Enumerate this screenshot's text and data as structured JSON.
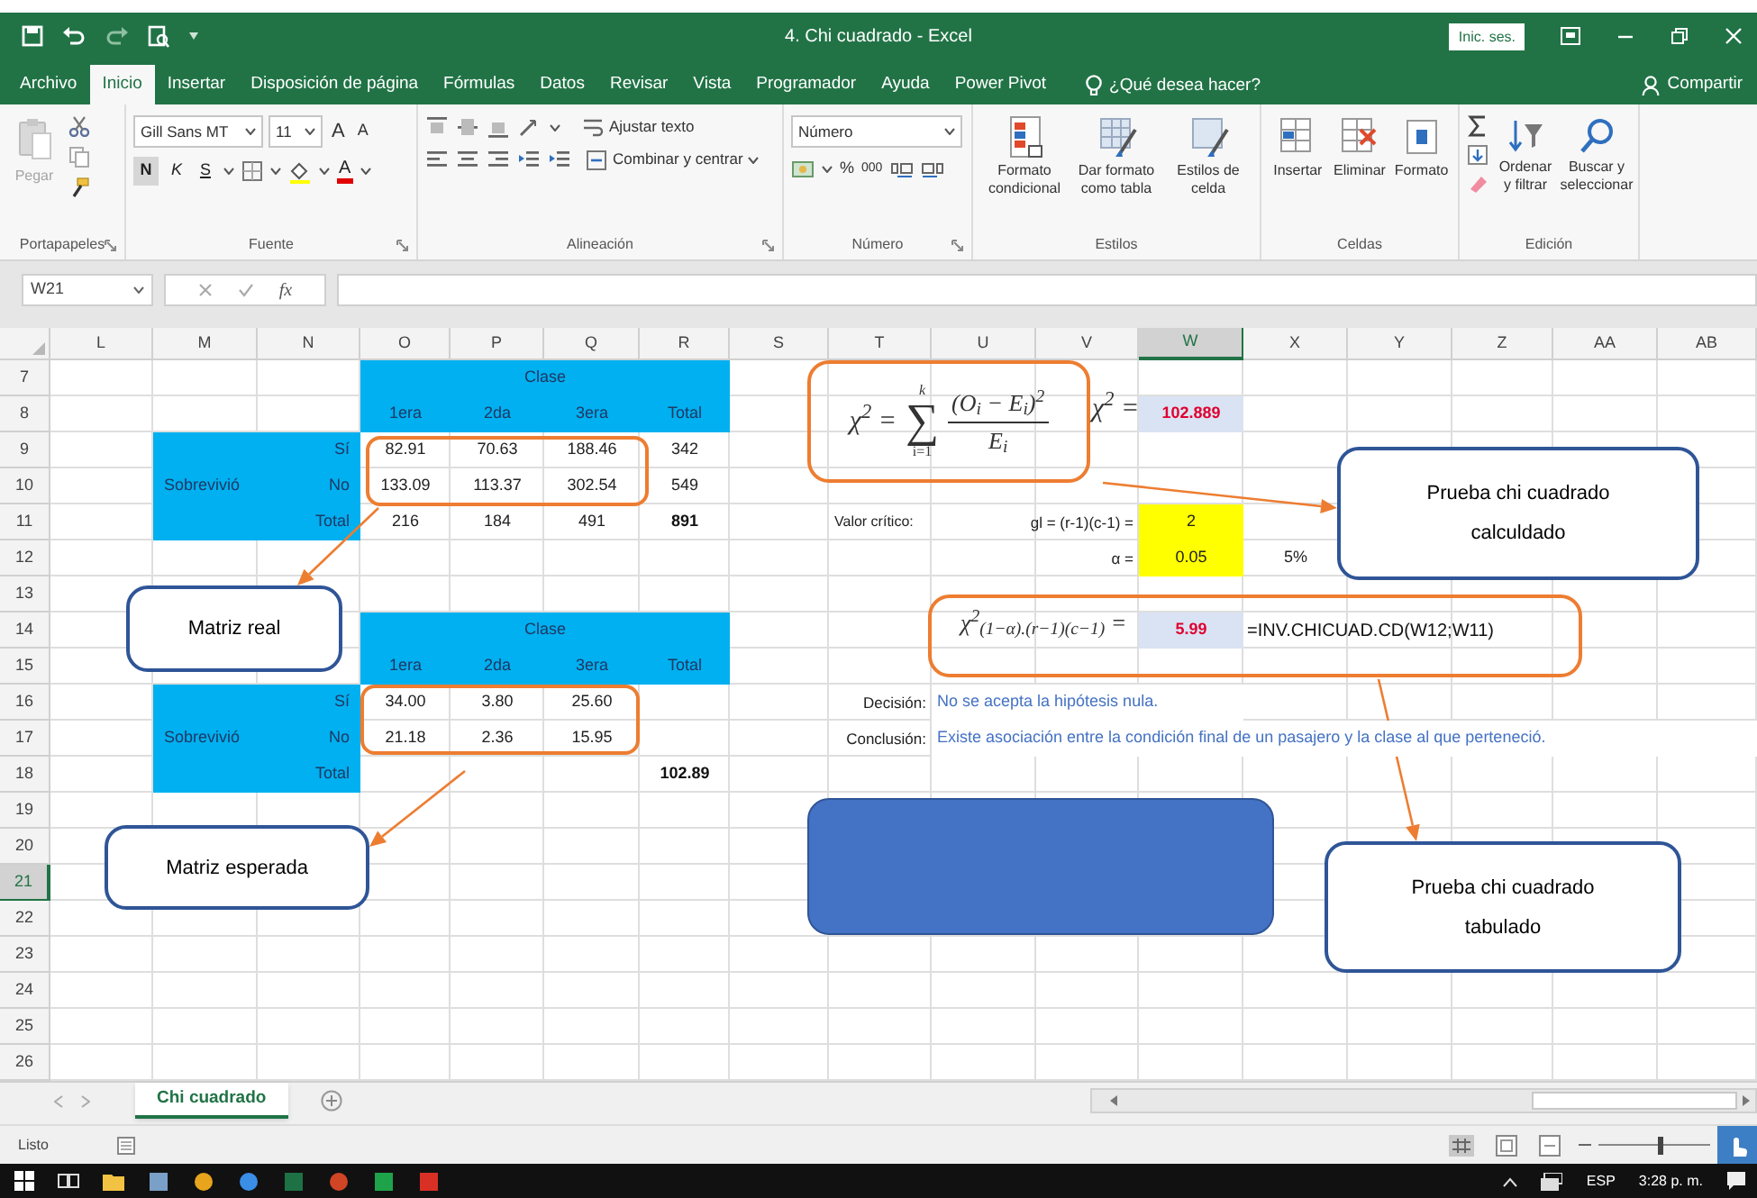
{
  "window": {
    "title": "4. Chi cuadrado - Excel",
    "sign_in": "Inic. ses."
  },
  "menu_tabs": [
    {
      "label": "Archivo",
      "selected": false
    },
    {
      "label": "Inicio",
      "selected": true
    },
    {
      "label": "Insertar",
      "selected": false
    },
    {
      "label": "Disposición de página",
      "selected": false
    },
    {
      "label": "Fórmulas",
      "selected": false
    },
    {
      "label": "Datos",
      "selected": false
    },
    {
      "label": "Revisar",
      "selected": false
    },
    {
      "label": "Vista",
      "selected": false
    },
    {
      "label": "Programador",
      "selected": false
    },
    {
      "label": "Ayuda",
      "selected": false
    },
    {
      "label": "Power Pivot",
      "selected": false
    }
  ],
  "tell_me": {
    "placeholder": "¿Qué desea hacer?"
  },
  "share": "Compartir",
  "ribbon": {
    "clipboard": {
      "paste": {
        "label": "Pegar",
        "disabled": true
      },
      "label": "Portapapeles"
    },
    "font": {
      "name": "Gill Sans MT",
      "size": "11",
      "grow": "A",
      "shrink": "A",
      "bold": "N",
      "italic": "K",
      "underline": "S",
      "font_color_button": "A",
      "label": "Fuente"
    },
    "alignment": {
      "wrap": "Ajustar texto",
      "merge": "Combinar y centrar",
      "label": "Alineación"
    },
    "number": {
      "format": "Número",
      "percent": "%",
      "thousands": "000",
      "label": "Número"
    },
    "styles": {
      "buttons": [
        "Formato condicional",
        "Dar formato como tabla",
        "Estilos de celda"
      ],
      "label": "Estilos"
    },
    "cells": {
      "buttons": [
        "Insertar",
        "Eliminar",
        "Formato"
      ],
      "label": "Celdas"
    },
    "editing": {
      "buttons": [
        "Ordenar y filtrar",
        "Buscar y seleccionar"
      ],
      "label": "Edición"
    }
  },
  "formula_bar": {
    "name_box": "W21",
    "function_button": "fx"
  },
  "columns": [
    {
      "label": "L",
      "selected": false
    },
    {
      "label": "M",
      "selected": false
    },
    {
      "label": "N",
      "selected": false
    },
    {
      "label": "O",
      "selected": false
    },
    {
      "label": "P",
      "selected": false
    },
    {
      "label": "Q",
      "selected": false
    },
    {
      "label": "R",
      "selected": false
    },
    {
      "label": "S",
      "selected": false
    },
    {
      "label": "T",
      "selected": false
    },
    {
      "label": "U",
      "selected": false
    },
    {
      "label": "V",
      "selected": false
    },
    {
      "label": "W",
      "selected": true
    },
    {
      "label": "X",
      "selected": false
    },
    {
      "label": "Y",
      "selected": false
    },
    {
      "label": "Z",
      "selected": false
    },
    {
      "label": "AA",
      "selected": false
    },
    {
      "label": "AB",
      "selected": false
    }
  ],
  "rows": [
    {
      "label": "7",
      "selected": false
    },
    {
      "label": "8",
      "selected": false
    },
    {
      "label": "9",
      "selected": false
    },
    {
      "label": "10",
      "selected": false
    },
    {
      "label": "11",
      "selected": false
    },
    {
      "label": "12",
      "selected": false
    },
    {
      "label": "13",
      "selected": false
    },
    {
      "label": "14",
      "selected": false
    },
    {
      "label": "15",
      "selected": false
    },
    {
      "label": "16",
      "selected": false
    },
    {
      "label": "17",
      "selected": false
    },
    {
      "label": "18",
      "selected": false
    },
    {
      "label": "19",
      "selected": false
    },
    {
      "label": "20",
      "selected": false
    },
    {
      "label": "21",
      "selected": true
    },
    {
      "label": "22",
      "selected": false
    },
    {
      "label": "23",
      "selected": false
    },
    {
      "label": "24",
      "selected": false
    },
    {
      "label": "25",
      "selected": false
    },
    {
      "label": "26",
      "selected": false
    }
  ],
  "cells": [
    {
      "text": "Clase",
      "kind": "header"
    },
    {
      "text": "1era",
      "kind": "header"
    },
    {
      "text": "2da",
      "kind": "header"
    },
    {
      "text": "3era",
      "kind": "header"
    },
    {
      "text": "Total",
      "kind": "header"
    },
    {
      "text": "102.889",
      "kind": "result"
    },
    {
      "text": "Sobrevivió",
      "kind": "group-label"
    },
    {
      "text": "Sí",
      "kind": "row-label"
    },
    {
      "text": "82.91",
      "kind": "value"
    },
    {
      "text": "70.63",
      "kind": "value"
    },
    {
      "text": "188.46",
      "kind": "value"
    },
    {
      "text": "342",
      "kind": "value"
    },
    {
      "text": "No",
      "kind": "row-label"
    },
    {
      "text": "133.09",
      "kind": "value"
    },
    {
      "text": "113.37",
      "kind": "value"
    },
    {
      "text": "302.54",
      "kind": "value"
    },
    {
      "text": "549",
      "kind": "value"
    },
    {
      "text": "Total",
      "kind": "row-label"
    },
    {
      "text": "216",
      "kind": "value"
    },
    {
      "text": "184",
      "kind": "value"
    },
    {
      "text": "491",
      "kind": "value"
    },
    {
      "text": "891",
      "kind": "total"
    },
    {
      "text": "Valor crítico:",
      "kind": "label"
    },
    {
      "text": "gl = (r-1)(c-1) =",
      "kind": "label-right"
    },
    {
      "text": "2",
      "kind": "input"
    },
    {
      "text": "α =",
      "kind": "label-right"
    },
    {
      "text": "0.05",
      "kind": "input"
    },
    {
      "text": "5%",
      "kind": "value"
    },
    {
      "text": "Clase",
      "kind": "header"
    },
    {
      "text": "5.99",
      "kind": "result"
    },
    {
      "text": "=INV.CHICUAD.CD(W12;W11)",
      "kind": "formula"
    },
    {
      "text": "1era",
      "kind": "header"
    },
    {
      "text": "2da",
      "kind": "header"
    },
    {
      "text": "3era",
      "kind": "header"
    },
    {
      "text": "Total",
      "kind": "header"
    },
    {
      "text": "Sobrevivió",
      "kind": "group-label"
    },
    {
      "text": "Sí",
      "kind": "row-label"
    },
    {
      "text": "34.00",
      "kind": "value"
    },
    {
      "text": "3.80",
      "kind": "value"
    },
    {
      "text": "25.60",
      "kind": "value"
    },
    {
      "text": "Decisión:",
      "kind": "label-right"
    },
    {
      "text": "No se acepta la hipótesis nula.",
      "kind": "note"
    },
    {
      "text": "No",
      "kind": "row-label"
    },
    {
      "text": "21.18",
      "kind": "value"
    },
    {
      "text": "2.36",
      "kind": "value"
    },
    {
      "text": "15.95",
      "kind": "value"
    },
    {
      "text": "Conclusión:",
      "kind": "label-right"
    },
    {
      "text": "Existe asociación entre la condición final de un pasajero y la clase al que perteneció.",
      "kind": "note"
    },
    {
      "text": "Total",
      "kind": "row-label"
    },
    {
      "text": "102.89",
      "kind": "total"
    }
  ],
  "equations": [
    {
      "kind": "sum",
      "lhs": "χ$^{2}$ =",
      "sum_top": "k",
      "sum_symbol": "∑",
      "sum_bottom": "i=1",
      "numerator": "(O$_{i}$ − E$_{i}$)$^{2}$",
      "denominator": "E$_{i}$"
    },
    {
      "kind": "inline",
      "text": "χ$^{2}$ ="
    },
    {
      "kind": "inline",
      "text": "χ$^{2}$$_{(1−α).(r−1)(c−1)}$ ="
    }
  ],
  "callouts": [
    {
      "text": "Matriz real"
    },
    {
      "text": "Matriz esperada"
    },
    {
      "text": "Prueba chi cuadrado calculdado"
    },
    {
      "text": "Prueba chi cuadrado tabulado"
    }
  ],
  "sheet_tabs": [
    {
      "label": "Chi cuadrado",
      "selected": true
    }
  ],
  "status_bar": {
    "text": "Listo",
    "zoom_slider": {
      "level": 0.55
    }
  },
  "taskbar": {
    "language": "ESP",
    "time": "3:28 p. m."
  }
}
